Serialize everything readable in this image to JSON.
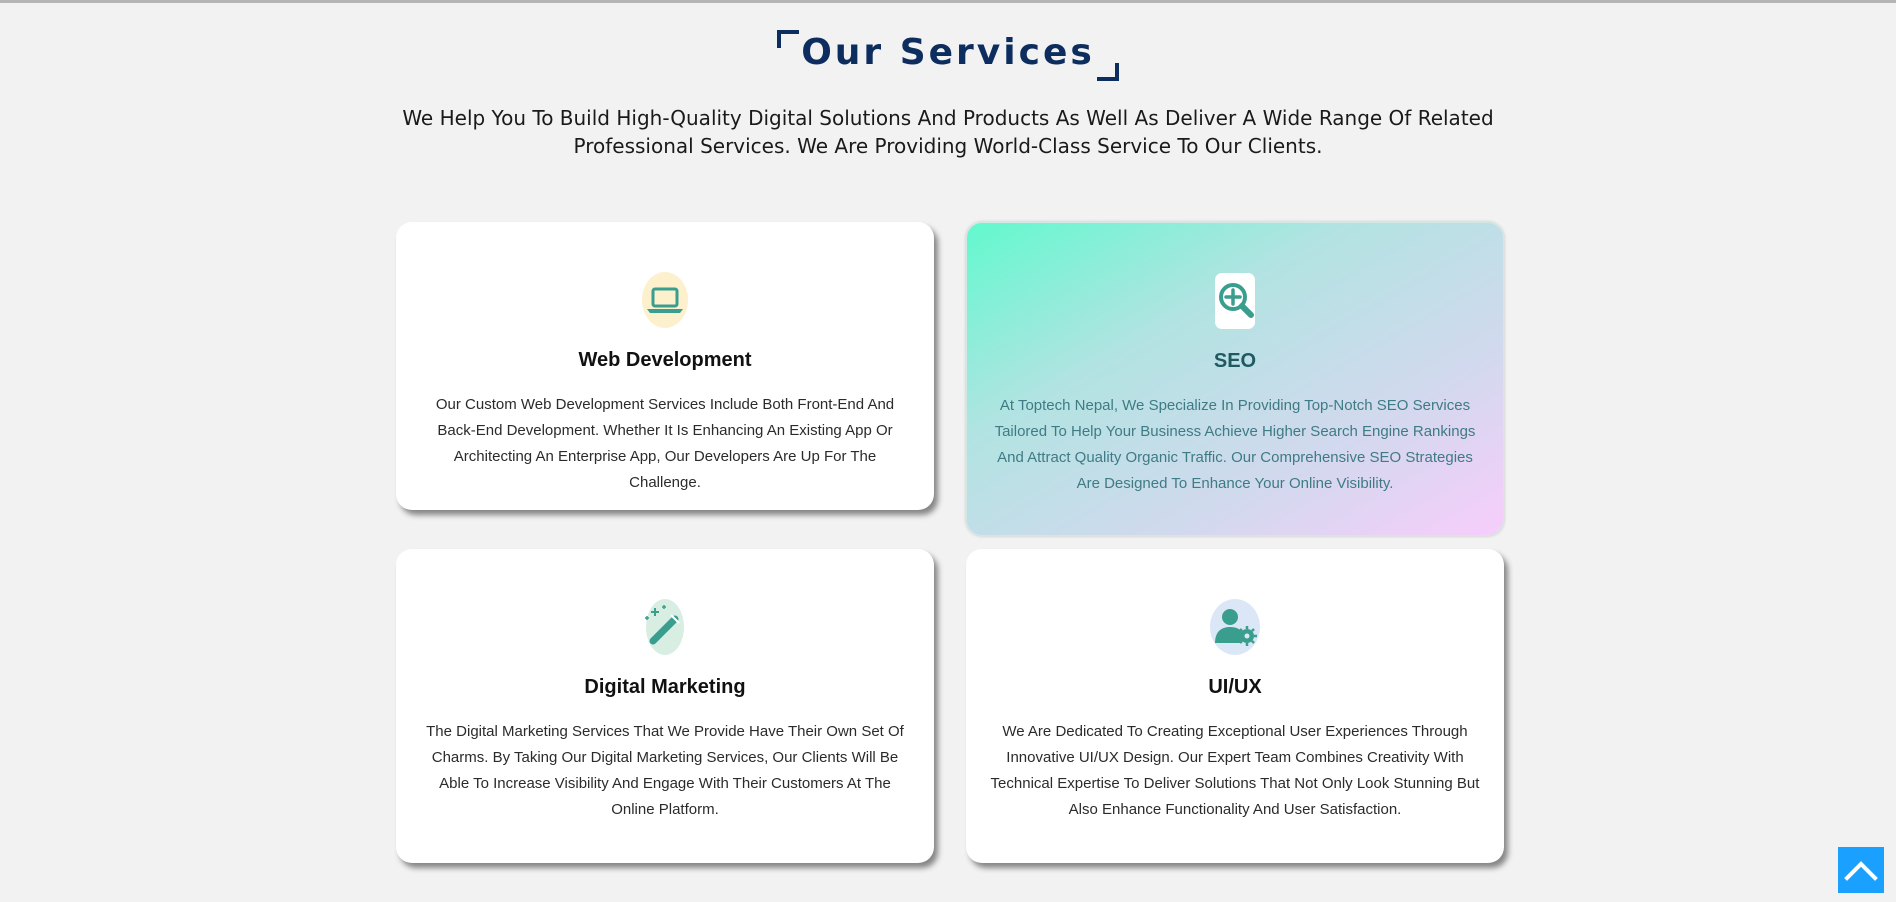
{
  "header": {
    "title": "Our Services",
    "subtitle": "We Help You To Build High-Quality Digital Solutions And Products As Well As Deliver A Wide Range Of Related Professional Services. We Are Providing World-Class Service To Our Clients."
  },
  "services": [
    {
      "icon": "laptop-icon",
      "title": "Web Development",
      "description": "Our Custom Web Development Services Include Both Front-End And Back-End Development. Whether It Is Enhancing An Existing App Or Architecting An Enterprise App, Our Developers Are Up For The Challenge."
    },
    {
      "icon": "search-plus-icon",
      "title": "SEO",
      "description": "At Toptech Nepal, We Specialize In Providing Top-Notch SEO Services Tailored To Help Your Business Achieve Higher Search Engine Rankings And Attract Quality Organic Traffic. Our Comprehensive SEO Strategies Are Designed To Enhance Your Online Visibility."
    },
    {
      "icon": "magic-wand-icon",
      "title": "Digital Marketing",
      "description": "The Digital Marketing Services That We Provide Have Their Own Set Of Charms. By Taking Our Digital Marketing Services, Our Clients Will Be Able To Increase Visibility And Engage With Their Customers At The Online Platform."
    },
    {
      "icon": "user-gear-icon",
      "title": "UI/UX",
      "description": "We Are Dedicated To Creating Exceptional User Experiences Through Innovative UI/UX Design. Our Expert Team Combines Creativity With Technical Expertise To Deliver Solutions That Not Only Look Stunning But Also Enhance Functionality And User Satisfaction."
    }
  ],
  "scroll_top": {
    "icon": "chevron-up-icon"
  },
  "colors": {
    "page_background": "#f2f2f2",
    "title": "#0d2d5e",
    "icon_accent": "#3a9e8f",
    "scroll_button": "#1aa0ff",
    "highlight_gradient_start": "#62f9ce",
    "highlight_gradient_end": "#f7cdfb"
  }
}
